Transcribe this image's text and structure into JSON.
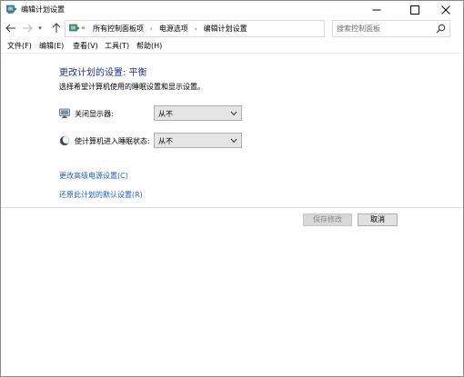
{
  "window": {
    "title": "编辑计划设置"
  },
  "nav": {
    "recent_arrow": "▾",
    "breadcrumb_prefix": "«",
    "breadcrumbs": [
      {
        "label": "所有控制面板项"
      },
      {
        "label": "电源选项"
      },
      {
        "label": "编辑计划设置"
      }
    ],
    "separator": "›"
  },
  "search": {
    "placeholder": "搜索控制面板"
  },
  "menu": {
    "items": [
      {
        "label": "文件(F)"
      },
      {
        "label": "编辑(E)"
      },
      {
        "label": "查看(V)"
      },
      {
        "label": "工具(T)"
      },
      {
        "label": "帮助(H)"
      }
    ]
  },
  "content": {
    "title": "更改计划的设置: 平衡",
    "subtitle": "选择希望计算机使用的睡眠设置和显示设置。",
    "settings": [
      {
        "label": "关闭显示器:",
        "value": "从不",
        "icon": "monitor-icon"
      },
      {
        "label": "使计算机进入睡眠状态:",
        "value": "从不",
        "icon": "moon-icon"
      }
    ],
    "links": [
      {
        "label": "更改高级电源设置(C)"
      },
      {
        "label": "还原此计划的默认设置(R)"
      }
    ],
    "buttons": {
      "save": "保存修改",
      "cancel": "取消"
    }
  },
  "colors": {
    "title_blue": "#1e3287",
    "link_blue": "#1a5fb4",
    "disabled_text": "#8a8a8a"
  }
}
